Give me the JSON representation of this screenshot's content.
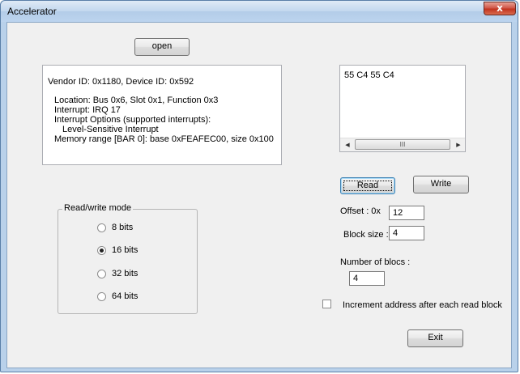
{
  "window": {
    "title": "Accelerator",
    "close_glyph": "x"
  },
  "actions": {
    "open_label": "open",
    "read_label": "Read",
    "write_label": "Write",
    "exit_label": "Exit"
  },
  "device_info": {
    "lines": [
      "Vendor ID: 0x1180, Device ID: 0x592",
      "Location: Bus 0x6, Slot 0x1, Function 0x3",
      "Interrupt: IRQ 17",
      "Interrupt Options (supported interrupts):",
      "Level-Sensitive Interrupt",
      "Memory range [BAR 0]: base 0xFEAFEC00, size 0x100"
    ]
  },
  "data_view": {
    "text": "55 C4 55 C4",
    "scroll_left_glyph": "◀",
    "scroll_right_glyph": "▶",
    "thumb_grip": "III"
  },
  "rw_mode": {
    "title": "Read/write mode",
    "options": [
      {
        "label": "8 bits",
        "checked": false
      },
      {
        "label": "16 bits",
        "checked": true
      },
      {
        "label": "32 bits",
        "checked": false
      },
      {
        "label": "64 bits",
        "checked": false
      }
    ]
  },
  "fields": {
    "offset_label": "Offset :  0x",
    "offset_value": "12",
    "block_size_label": "Block size :",
    "block_size_value": "4",
    "num_blocs_label": "Number of blocs :",
    "num_blocs_value": "4"
  },
  "options": {
    "increment_label": "Increment address after each read block",
    "increment_checked": false
  },
  "icons": {
    "close": "close-icon",
    "scroll_left": "scroll-left-icon",
    "scroll_right": "scroll-right-icon"
  }
}
